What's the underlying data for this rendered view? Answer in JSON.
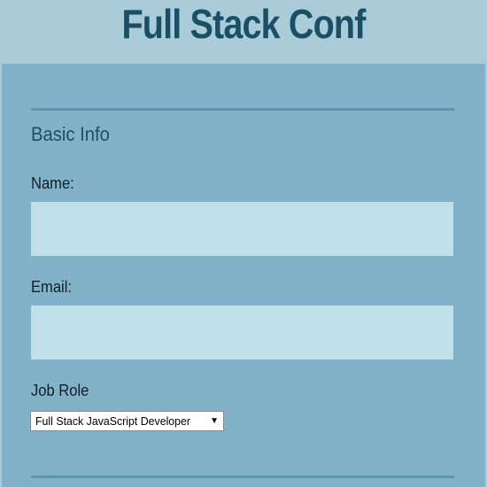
{
  "header": {
    "title": "Full Stack Conf"
  },
  "form": {
    "section_legend": "Basic Info",
    "name": {
      "label": "Name:",
      "value": ""
    },
    "email": {
      "label": "Email:",
      "value": ""
    },
    "job_role": {
      "label": "Job Role",
      "selected": "Full Stack JavaScript Developer",
      "arrow_icon": "triangle-down-icon"
    }
  },
  "colors": {
    "header_bg": "#a9ccd8",
    "panel_bg": "#82b2c9",
    "title_text": "#1b4f66",
    "input_bg": "#bfdfe9",
    "divider": "#5d95ad"
  }
}
